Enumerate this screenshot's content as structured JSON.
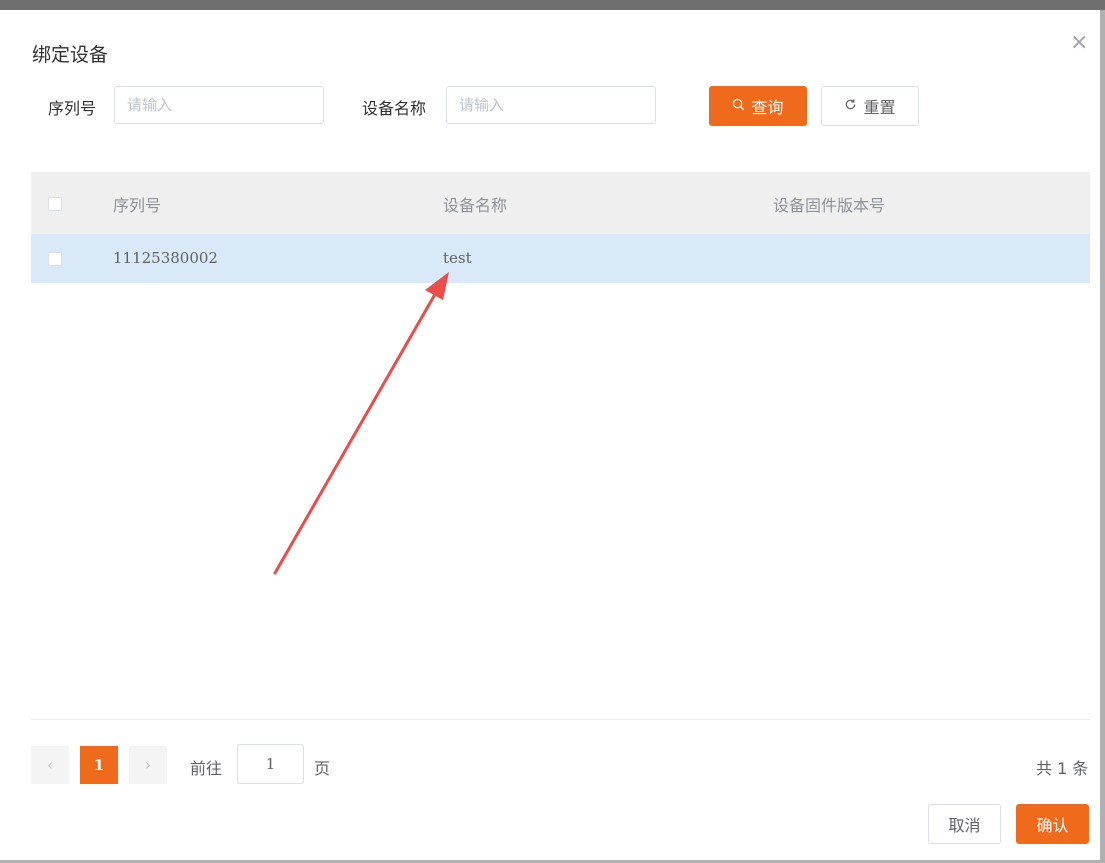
{
  "dialog": {
    "title": "绑定设备",
    "close_glyph": "×"
  },
  "search": {
    "serial_label": "序列号",
    "serial_placeholder": "请输入",
    "name_label": "设备名称",
    "name_placeholder": "请输入",
    "query_label": "查询",
    "reset_label": "重置"
  },
  "table": {
    "columns": [
      "序列号",
      "设备名称",
      "设备固件版本号"
    ],
    "rows": [
      {
        "serial": "11125380002",
        "name": "test",
        "firmware": ""
      }
    ]
  },
  "pagination": {
    "prev_glyph": "‹",
    "current_page": "1",
    "next_glyph": "›",
    "goto_label": "前往",
    "goto_value": "1",
    "page_suffix": "页",
    "total_text": "共 1 条"
  },
  "footer": {
    "cancel_label": "取消",
    "confirm_label": "确认"
  },
  "colors": {
    "primary": "#f06a1c",
    "row_highlight": "#d9e9f7",
    "annotation_arrow": "#ef4b4b"
  },
  "icons": {
    "query": "search-icon",
    "reset": "refresh-icon",
    "close": "close-icon"
  }
}
